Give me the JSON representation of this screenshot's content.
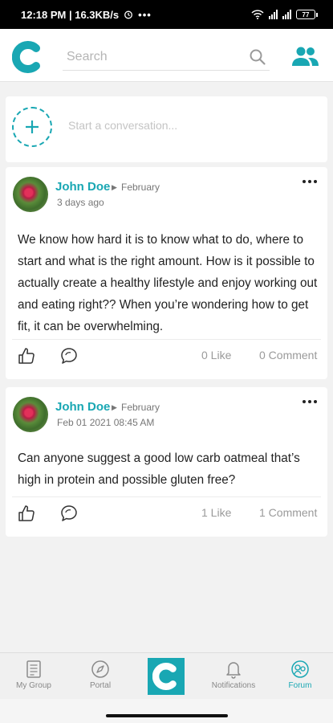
{
  "status_bar": {
    "time_speed": "12:18 PM | 16.3KB/s",
    "battery": "77"
  },
  "header": {
    "logo_letter": "C",
    "search_placeholder": "Search",
    "brand_color": "#19a7b3"
  },
  "composer": {
    "placeholder": "Start a conversation..."
  },
  "posts": [
    {
      "author": "John Doe",
      "group": "February",
      "time": "3 days ago",
      "body": "We know how hard it is to know what to do, where to start and what is the right amount. How is it possible to actually create a healthy lifestyle and enjoy working out and eating right?? When you’re wondering how to get fit, it can be overwhelming.",
      "likes": "0 Like",
      "comments": "0 Comment"
    },
    {
      "author": "John Doe",
      "group": "February",
      "time": "Feb 01 2021 08:45 AM",
      "body": "Can anyone suggest a good low carb oatmeal that’s high in protein and possible gluten free?",
      "likes": "1 Like",
      "comments": "1 Comment"
    }
  ],
  "nav": {
    "items": [
      {
        "label": "My Group",
        "icon": "document-icon"
      },
      {
        "label": "Portal",
        "icon": "compass-icon"
      },
      {
        "label": "",
        "icon": "app-logo"
      },
      {
        "label": "Notifications",
        "icon": "bell-icon"
      },
      {
        "label": "Forum",
        "icon": "forum-icon",
        "active": true
      }
    ]
  }
}
